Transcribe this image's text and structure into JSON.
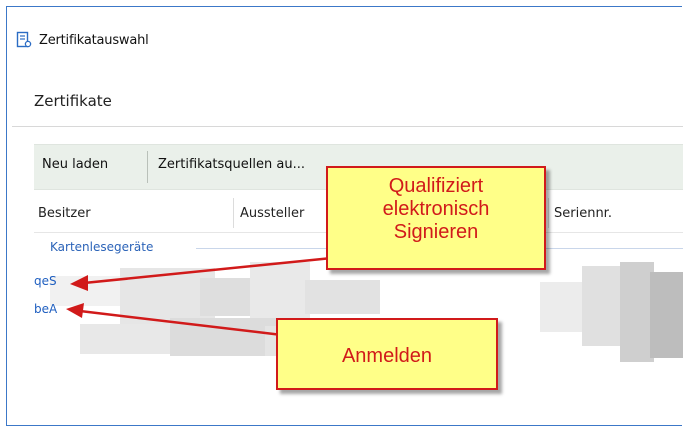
{
  "window": {
    "title": "Zertifikatauswahl",
    "icon": "certificate-icon"
  },
  "section": {
    "title": "Zertifikate"
  },
  "toolbar": {
    "reload_label": "Neu laden",
    "sources_label": "Zertifikatsquellen au..."
  },
  "table": {
    "columns": [
      "Besitzer",
      "Aussteller",
      "Seriennr."
    ],
    "group_label": "Kartenlesegeräte",
    "rows": [
      {
        "owner": "qeS"
      },
      {
        "owner": "beA"
      }
    ]
  },
  "annotations": {
    "qualified": "Qualifiziert elektronisch Signieren",
    "login": "Anmelden",
    "color": "#d11a1a",
    "fill": "#ffff88"
  },
  "colors": {
    "window_border": "#3c78c8",
    "toolbar_bg": "#eaf0ea",
    "link_blue": "#1f5fc0"
  }
}
